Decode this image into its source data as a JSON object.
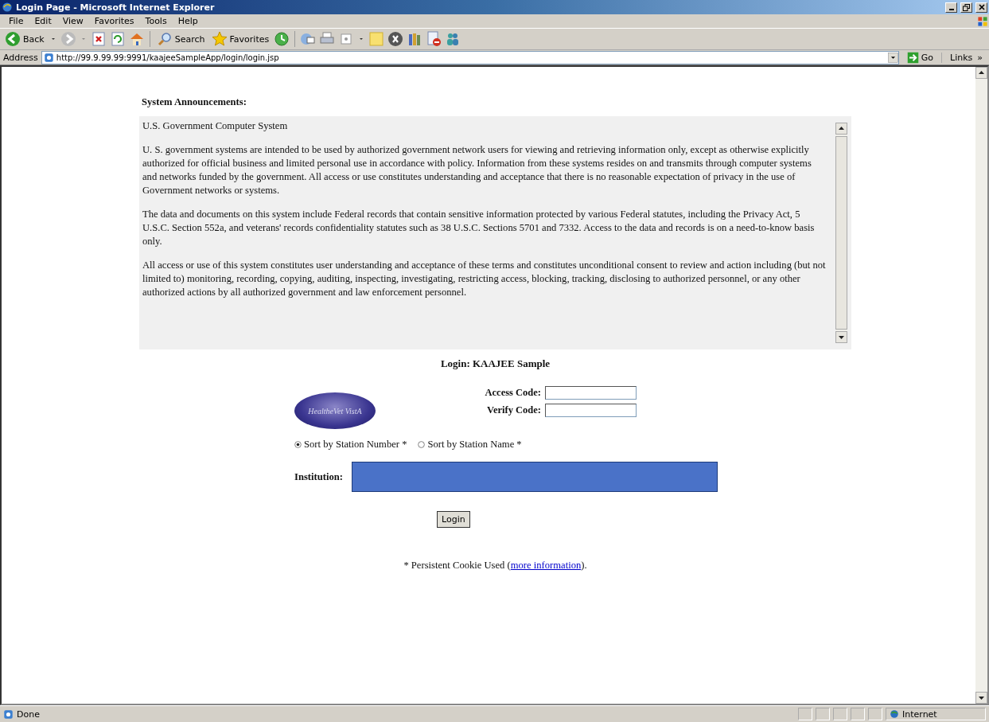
{
  "window": {
    "title": "Login Page - Microsoft Internet Explorer"
  },
  "menu": [
    "File",
    "Edit",
    "View",
    "Favorites",
    "Tools",
    "Help"
  ],
  "toolbar": {
    "back": "Back",
    "search": "Search",
    "favorites": "Favorites"
  },
  "address": {
    "label": "Address",
    "value": "http://99.9.99.99:9991/kaajeeSampleApp/login/login.jsp",
    "go": "Go",
    "links": "Links",
    "chevron": "»"
  },
  "page": {
    "announcements_title": "System Announcements:",
    "announcements": [
      "U.S. Government Computer System",
      "U. S. government systems are intended to be used by authorized government network users for viewing and retrieving information only, except as otherwise explicitly authorized for official business and limited personal use in accordance with policy. Information from these systems resides on and transmits through computer systems and networks funded by the government. All access or use constitutes understanding and acceptance that there is no reasonable expectation of privacy in the use of Government networks or systems.",
      "The data and documents on this system include Federal records that contain sensitive information protected by various Federal statutes, including the Privacy Act, 5 U.S.C. Section 552a, and veterans' records confidentiality statutes such as 38 U.S.C. Sections 5701 and 7332. Access to the data and records is on a need-to-know basis only.",
      "All access or use of this system constitutes user understanding and acceptance of these terms and constitutes unconditional consent to review and action including (but not limited to) monitoring, recording, copying, auditing, inspecting, investigating, restricting access, blocking, tracking, disclosing to authorized personnel, or any other authorized actions by all authorized government and law enforcement personnel."
    ],
    "login_title": "Login: KAAJEE Sample",
    "logo": "HealtheVet VistA",
    "fields": [
      {
        "label": "Access Code:"
      },
      {
        "label": "Verify Code:"
      }
    ],
    "sort_options": [
      {
        "label": "Sort by Station Number *",
        "selected": true
      },
      {
        "label": "Sort by Station Name *",
        "selected": false
      }
    ],
    "institution_label": "Institution:",
    "login_button": "Login",
    "cookie_note": {
      "text": "* Persistent Cookie Used (",
      "link": "more information",
      "end": ")."
    }
  },
  "status_bar": {
    "text": "Done",
    "zone": "Internet"
  }
}
